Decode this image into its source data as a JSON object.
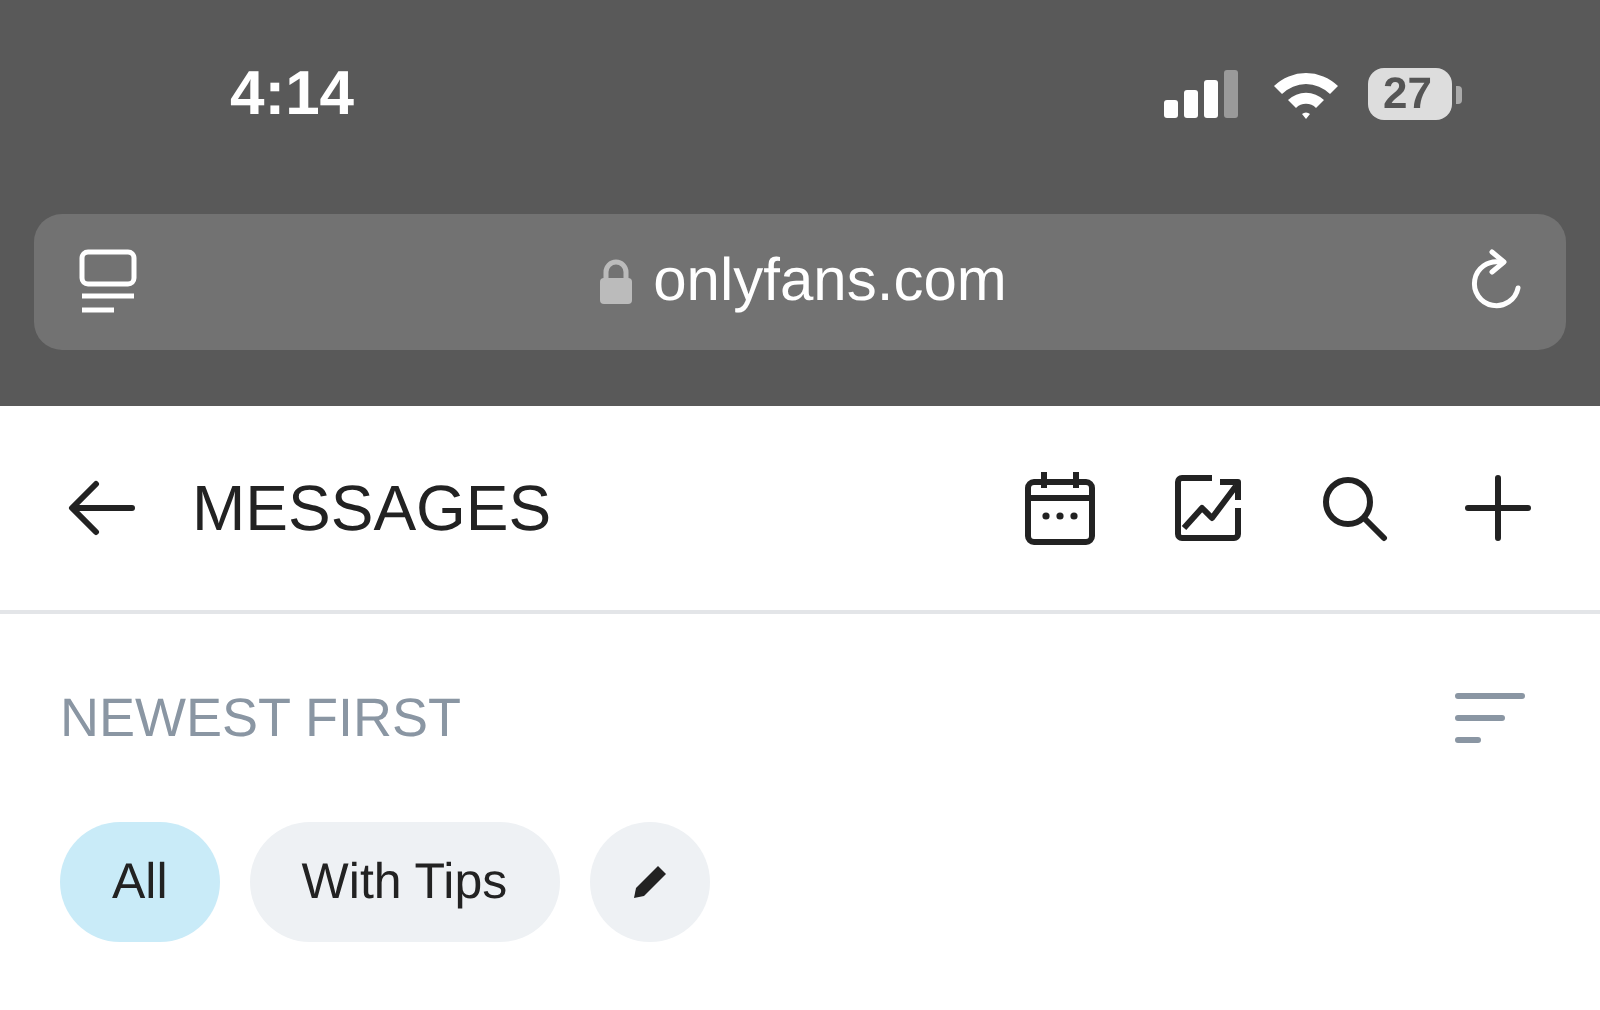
{
  "status_bar": {
    "time": "4:14",
    "battery": "27"
  },
  "address_bar": {
    "url": "onlyfans.com"
  },
  "header": {
    "title": "MESSAGES"
  },
  "sort": {
    "label": "NEWEST FIRST"
  },
  "filters": [
    {
      "label": "All",
      "selected": true
    },
    {
      "label": "With Tips",
      "selected": false
    }
  ]
}
